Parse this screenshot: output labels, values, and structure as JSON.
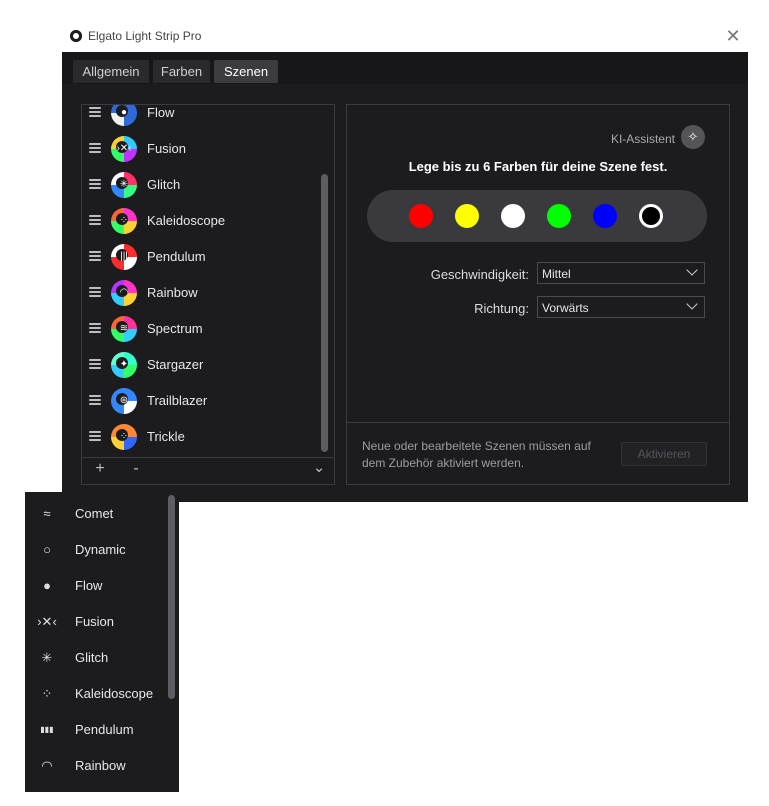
{
  "window": {
    "title": "Elgato Light Strip Pro",
    "close_glyph": "✕"
  },
  "tabs": [
    {
      "label": "Allgemein",
      "active": false
    },
    {
      "label": "Farben",
      "active": false
    },
    {
      "label": "Szenen",
      "active": true
    }
  ],
  "scene_list": {
    "items": [
      {
        "label": "Flow",
        "ring_colors": [
          "#2f6bd8",
          "#2f6bd8",
          "#f0f0f0",
          "#2f6bd8"
        ],
        "glyph": "●"
      },
      {
        "label": "Fusion",
        "ring_colors": [
          "#33c9ff",
          "#c033ff",
          "#33ff66",
          "#ffd233"
        ],
        "glyph": "›✕‹"
      },
      {
        "label": "Glitch",
        "ring_colors": [
          "#ff3366",
          "#33ff88",
          "#3388ff",
          "#ffffff"
        ],
        "glyph": "✳"
      },
      {
        "label": "Kaleidoscope",
        "ring_colors": [
          "#ff33cc",
          "#ffd233",
          "#33ff66",
          "#ff6633"
        ],
        "glyph": "⁘"
      },
      {
        "label": "Pendulum",
        "ring_colors": [
          "#ff2d2d",
          "#ffffff",
          "#ff2d2d",
          "#ffffff"
        ],
        "glyph": "|||"
      },
      {
        "label": "Rainbow",
        "ring_colors": [
          "#ff33cc",
          "#ffd233",
          "#33ccff",
          "#b833ff"
        ],
        "glyph": "◠"
      },
      {
        "label": "Spectrum",
        "ring_colors": [
          "#ff3399",
          "#33ccff",
          "#33ff66",
          "#ff6633"
        ],
        "glyph": "≋"
      },
      {
        "label": "Stargazer",
        "ring_colors": [
          "#33ffcc",
          "#33ff66",
          "#33ccff",
          "#66ffcc"
        ],
        "glyph": "✦"
      },
      {
        "label": "Trailblazer",
        "ring_colors": [
          "#3388ff",
          "#ffffff",
          "#3388ff",
          "#3388ff"
        ],
        "glyph": "⊛"
      },
      {
        "label": "Trickle",
        "ring_colors": [
          "#ff8833",
          "#3366ff",
          "#ffd233",
          "#ff8833"
        ],
        "glyph": "⁘"
      }
    ],
    "add_label": "+",
    "remove_label": "-",
    "expand_glyph": "⌄"
  },
  "editor": {
    "ai_assistant_label": "KI-Assistent",
    "ai_icon": "magic-wand-icon",
    "headline": "Lege bis zu 6 Farben für deine Szene fest.",
    "colors": [
      "#ff0000",
      "#ffff00",
      "#ffffff",
      "#00ff00",
      "#0000ff",
      "#000000"
    ],
    "speed_label": "Geschwindigkeit:",
    "speed_value": "Mittel",
    "direction_label": "Richtung:",
    "direction_value": "Vorwärts",
    "note": "Neue oder bearbeitete Szenen müssen auf dem Zubehör aktiviert werden.",
    "activate_label": "Aktivieren"
  },
  "popup_menu": {
    "items": [
      {
        "label": "Comet",
        "icon": "comet-icon",
        "glyph": "≈"
      },
      {
        "label": "Dynamic",
        "icon": "dynamic-ring-icon",
        "glyph": "○"
      },
      {
        "label": "Flow",
        "icon": "flow-icon",
        "glyph": "●"
      },
      {
        "label": "Fusion",
        "icon": "fusion-icon",
        "glyph": "›✕‹"
      },
      {
        "label": "Glitch",
        "icon": "glitch-icon",
        "glyph": "✳"
      },
      {
        "label": "Kaleidoscope",
        "icon": "kaleidoscope-icon",
        "glyph": "⁘"
      },
      {
        "label": "Pendulum",
        "icon": "pendulum-icon",
        "glyph": "▮▮▮"
      },
      {
        "label": "Rainbow",
        "icon": "rainbow-icon",
        "glyph": "◠"
      }
    ]
  }
}
